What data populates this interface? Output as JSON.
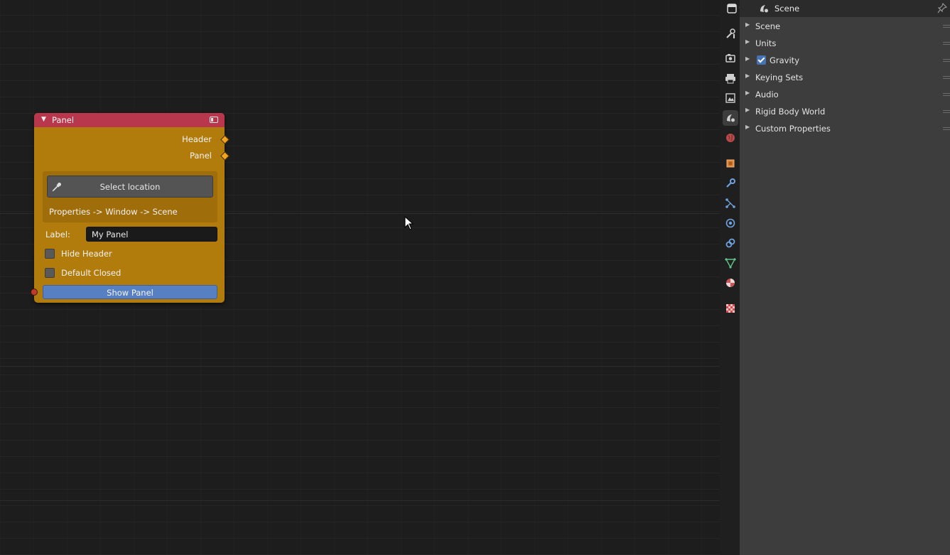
{
  "node": {
    "title": "Panel",
    "outputs": [
      "Header",
      "Panel"
    ],
    "select_location_label": "Select location",
    "location_path": "Properties -> Window -> Scene",
    "label_caption": "Label:",
    "label_value": "My Panel",
    "checkboxes": [
      {
        "label": "Hide Header",
        "checked": false
      },
      {
        "label": "Default Closed",
        "checked": false
      }
    ],
    "show_panel_label": "Show Panel",
    "colors": {
      "header": "#b8374c",
      "body": "#b27c0d",
      "button": "#5680c2"
    }
  },
  "properties": {
    "context_label": "Scene",
    "tabs": [
      "tool-icon",
      "render-icon",
      "output-icon",
      "view-layer-icon",
      "scene-icon",
      "world-icon",
      "object-icon",
      "modifier-icon",
      "particles-icon",
      "physics-icon",
      "constraints-icon",
      "data-icon",
      "material-icon",
      "texture-icon"
    ],
    "active_tab": "scene-icon",
    "sections": [
      {
        "label": "Scene"
      },
      {
        "label": "Units"
      },
      {
        "label": "Gravity",
        "checked": true
      },
      {
        "label": "Keying Sets"
      },
      {
        "label": "Audio"
      },
      {
        "label": "Rigid Body World"
      },
      {
        "label": "Custom Properties"
      }
    ]
  }
}
